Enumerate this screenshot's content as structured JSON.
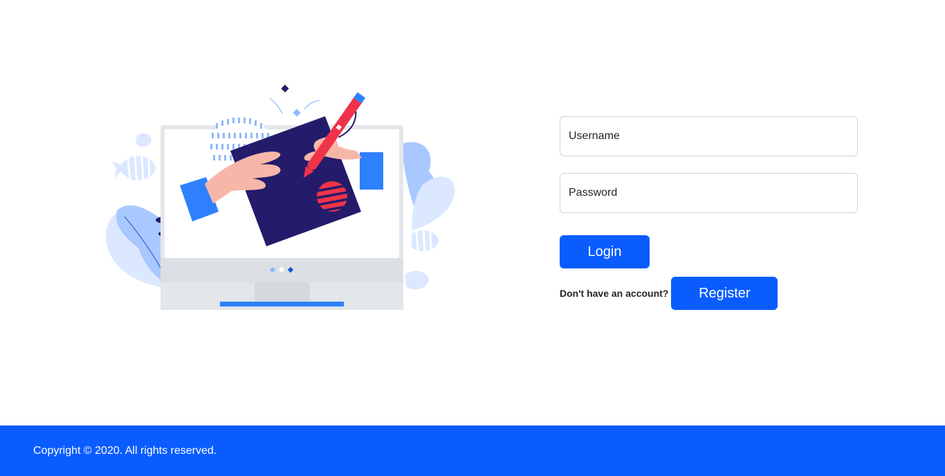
{
  "form": {
    "username_placeholder": "Username",
    "password_placeholder": "Password",
    "login_label": "Login",
    "register_prompt": "Don't have an account?",
    "register_label": "Register"
  },
  "footer": {
    "copyright": "Copyright © 2020. All rights reserved."
  },
  "colors": {
    "primary": "#0a5cff",
    "illustration_navy": "#241c6b",
    "illustration_red": "#f0334a",
    "illustration_light_blue": "#8fb8ff"
  },
  "icons": {
    "illustration": "computer-drawing-illustration"
  }
}
